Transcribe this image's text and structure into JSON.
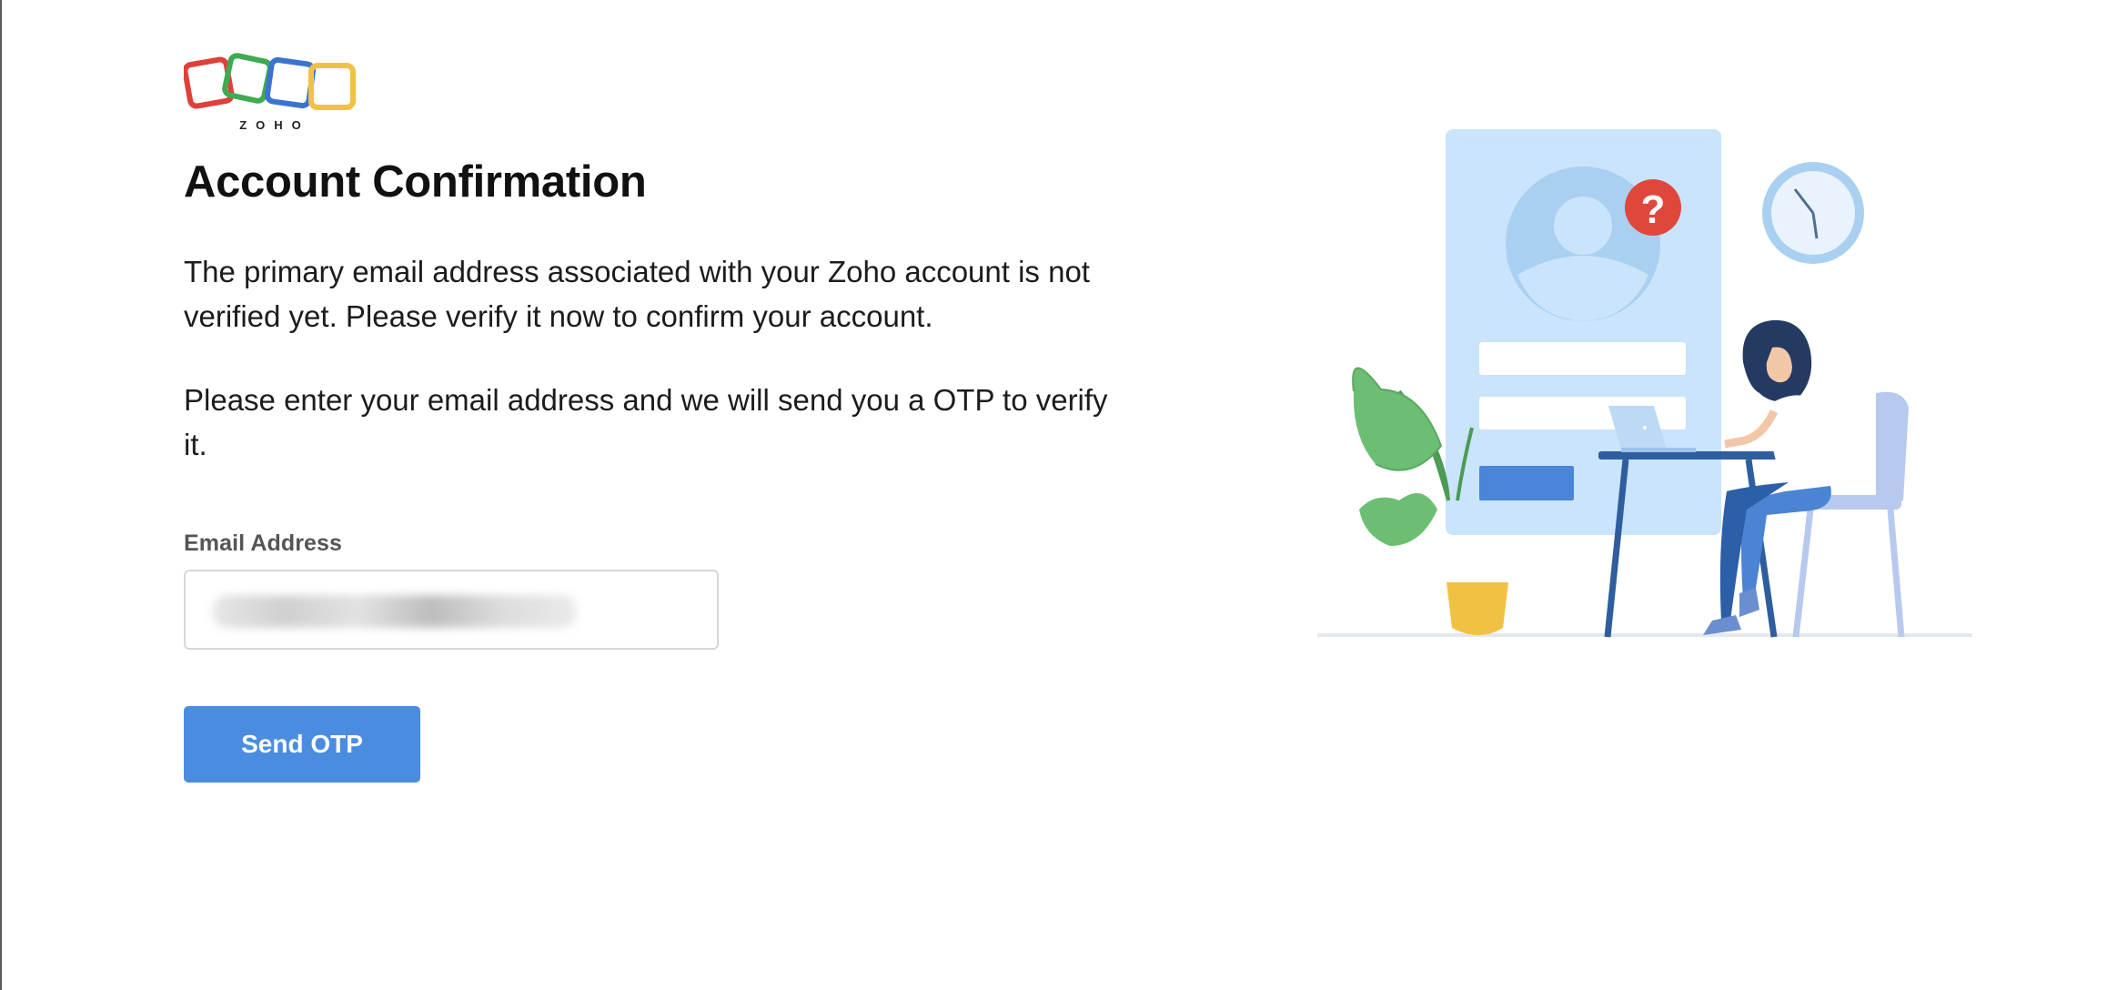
{
  "logo": {
    "text": "ZOHO",
    "colors": [
      "#e0403a",
      "#3faa4f",
      "#3b74cf",
      "#f2c143"
    ]
  },
  "title": "Account Confirmation",
  "description_1": "The primary email address associated with your Zoho account is not verified yet. Please verify it now to confirm your account.",
  "description_2": "Please enter your email address and we will send you a OTP to verify it.",
  "email": {
    "label": "Email Address",
    "value": ""
  },
  "send_button": {
    "label": "Send OTP",
    "color": "#4a8de0"
  },
  "illustration": {
    "question_mark": "?",
    "icons": [
      "profile-card-icon",
      "question-badge-icon",
      "clock-icon",
      "plant-icon",
      "laptop-icon",
      "woman-at-desk-icon"
    ]
  }
}
